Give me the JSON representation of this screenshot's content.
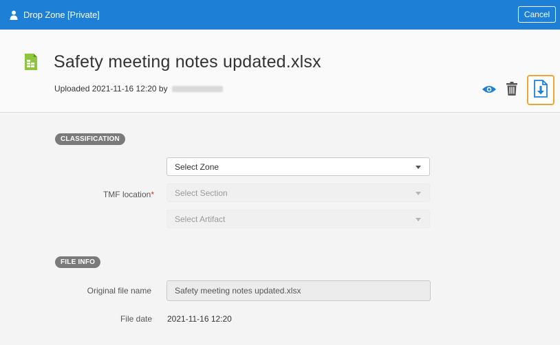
{
  "topbar": {
    "title": "Drop Zone [Private]",
    "user_icon": "user-icon",
    "cancel_label": "Cancel",
    "color": "#1e7fd6"
  },
  "document": {
    "title": "Safety meeting notes updated.xlsx",
    "file_icon": "xlsx-file-icon",
    "uploaded_prefix": "Uploaded 2021-11-16 12:20 by",
    "actions": [
      "eye-icon",
      "trash-icon",
      "download-icon"
    ],
    "highlight_color": "#f0a530"
  },
  "classification": {
    "heading": "CLASSIFICATION",
    "tmf_label": "TMF location",
    "required_mark": "*",
    "zone_placeholder": "Select Zone",
    "section_placeholder": "Select Section",
    "artifact_placeholder": "Select Artifact"
  },
  "file_info": {
    "heading": "FILE INFO",
    "original_name_label": "Original file name",
    "original_name_value": "Safety meeting notes updated.xlsx",
    "file_date_label": "File date",
    "file_date_value": "2021-11-16 12:20"
  }
}
